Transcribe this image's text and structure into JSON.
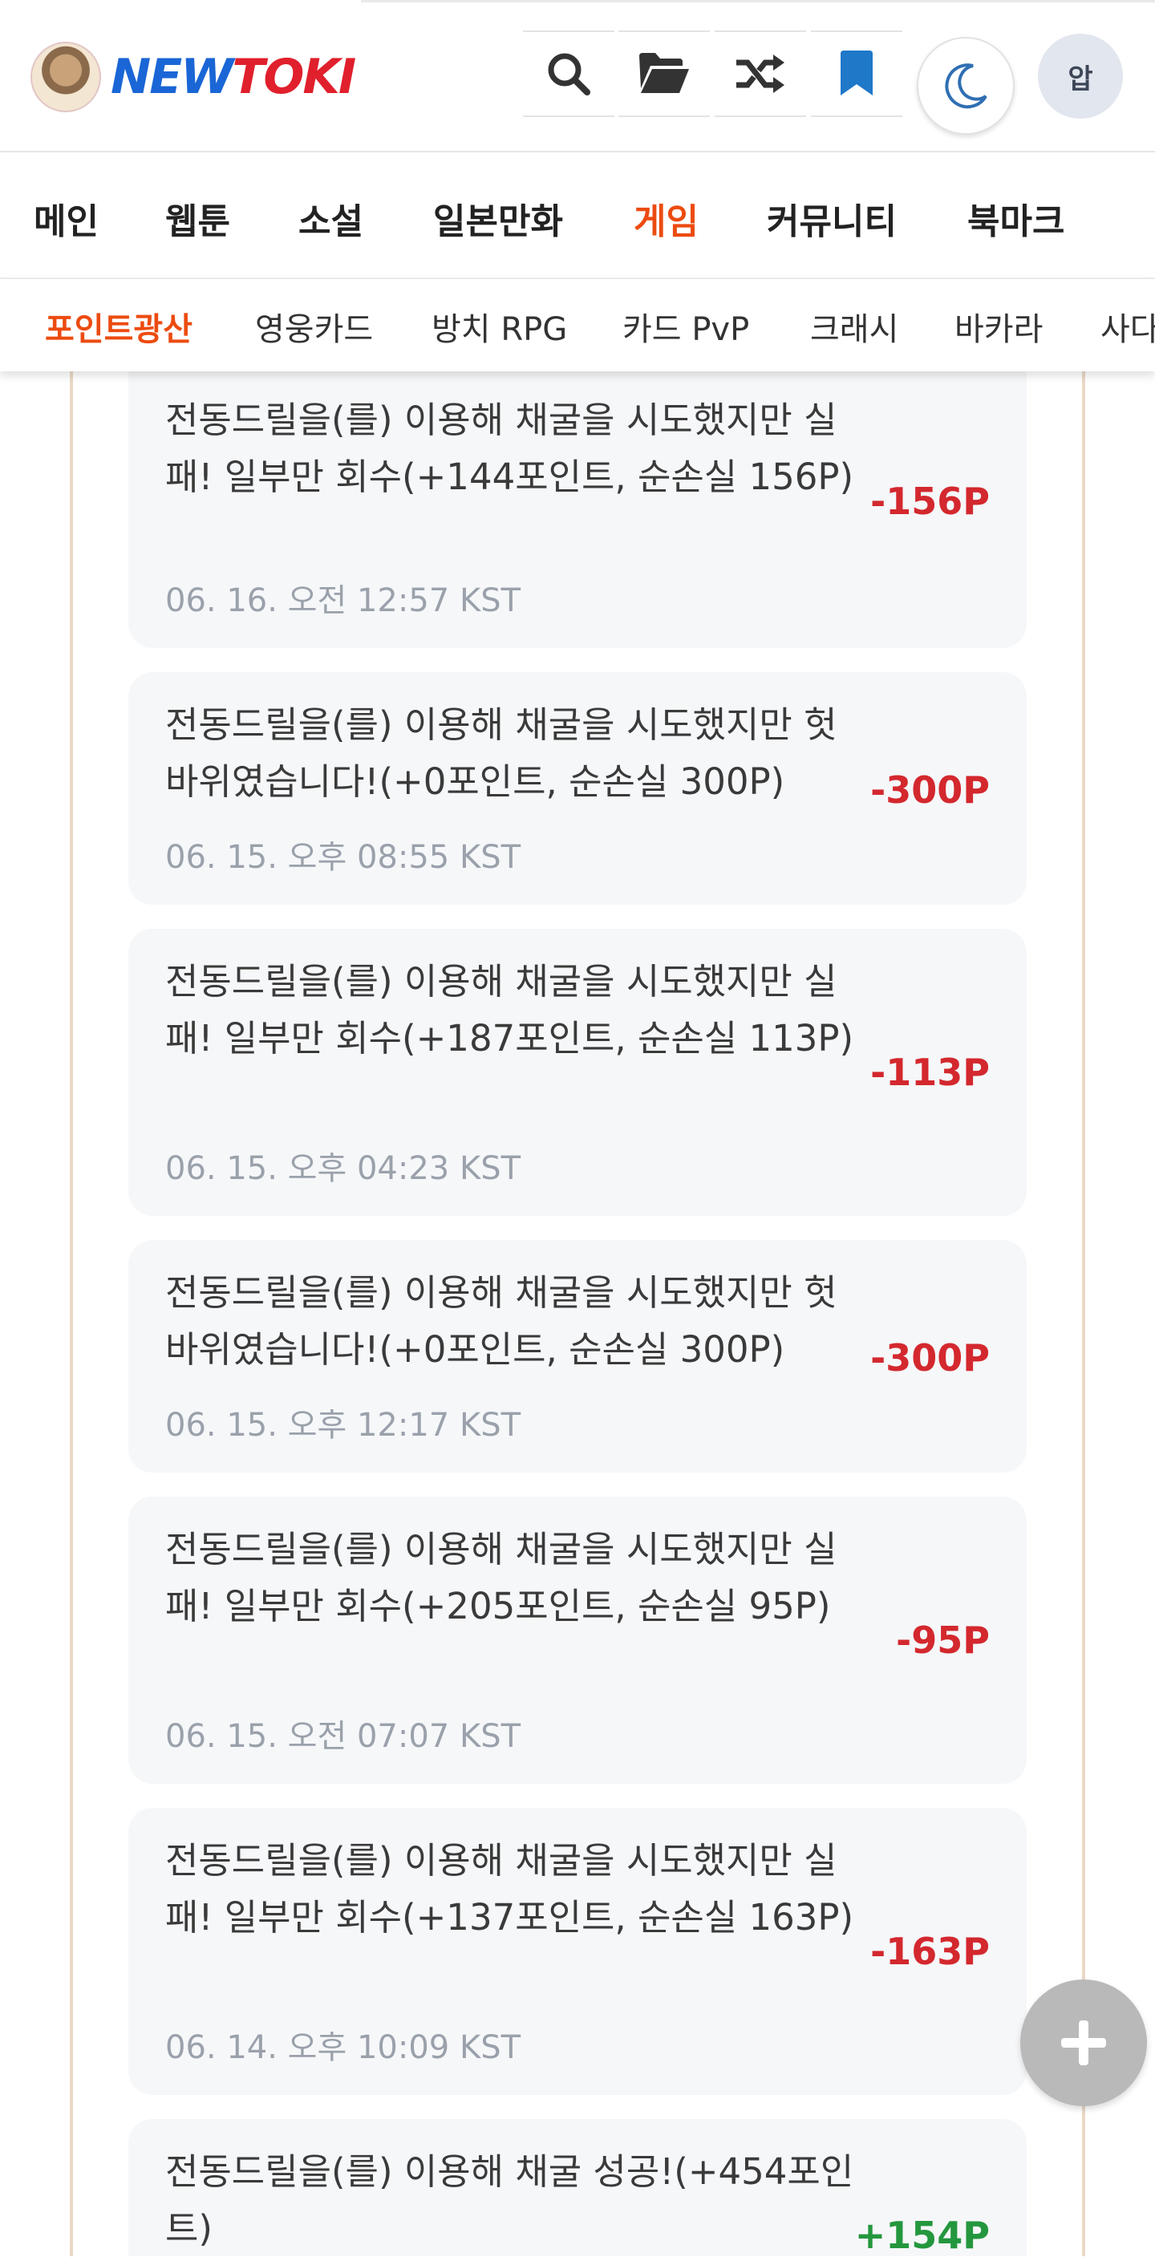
{
  "header": {
    "logo_new": "NEW",
    "logo_toki": "TOKI",
    "user_initial": "압",
    "icons": [
      "search-icon",
      "folder-icon",
      "shuffle-icon",
      "bookmark-icon",
      "moon-icon"
    ]
  },
  "main_nav": {
    "items": [
      "메인",
      "웹툰",
      "소설",
      "일본만화",
      "게임",
      "커뮤니티",
      "북마크"
    ],
    "active": "게임"
  },
  "sub_nav": {
    "items": [
      "포인트광산",
      "영웅카드",
      "방치 RPG",
      "카드 PvP",
      "크래시",
      "바카라",
      "사다리"
    ],
    "active": "포인트광산"
  },
  "entries": [
    {
      "desc": "전동드릴을(를) 이용해 채굴을 시도했지만 실패! 일부만 회수(+144포인트, 순손실 156P)",
      "time": "06. 16. 오전 12:57 KST",
      "amount": "-156P",
      "type": "minus"
    },
    {
      "desc": "전동드릴을(를) 이용해 채굴을 시도했지만 헛바위였습니다!(+0포인트, 순손실 300P)",
      "time": "06. 15. 오후 08:55 KST",
      "amount": "-300P",
      "type": "minus"
    },
    {
      "desc": "전동드릴을(를) 이용해 채굴을 시도했지만 실패! 일부만 회수(+187포인트, 순손실 113P)",
      "time": "06. 15. 오후 04:23 KST",
      "amount": "-113P",
      "type": "minus"
    },
    {
      "desc": "전동드릴을(를) 이용해 채굴을 시도했지만 헛바위였습니다!(+0포인트, 순손실 300P)",
      "time": "06. 15. 오후 12:17 KST",
      "amount": "-300P",
      "type": "minus"
    },
    {
      "desc": "전동드릴을(를) 이용해 채굴을 시도했지만 실패! 일부만 회수(+205포인트, 순손실 95P)",
      "time": "06. 15. 오전 07:07 KST",
      "amount": "-95P",
      "type": "minus"
    },
    {
      "desc": "전동드릴을(를) 이용해 채굴을 시도했지만 실패! 일부만 회수(+137포인트, 순손실 163P)",
      "time": "06. 14. 오후 10:09 KST",
      "amount": "-163P",
      "type": "minus"
    },
    {
      "desc": "전동드릴을(를) 이용해 채굴 성공!(+454포인트)",
      "time": "",
      "amount": "+154P",
      "type": "plus"
    }
  ],
  "colors": {
    "accent": "#ec4b10",
    "minus": "#d3282e",
    "plus": "#24973e",
    "card_bg": "#f6f7f9",
    "icon": "#333333",
    "bookmark": "#1f78c8",
    "moon": "#2f6fb3"
  }
}
